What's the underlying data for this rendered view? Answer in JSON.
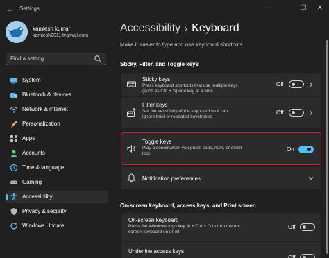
{
  "window": {
    "title": "Settings"
  },
  "user": {
    "name": "kamlesh kumar",
    "email": "kamlesh2011@gmail.com"
  },
  "search": {
    "placeholder": "Find a setting"
  },
  "sidebar": {
    "items": [
      {
        "label": "System",
        "icon": "monitor-icon",
        "color": "#4cc2ff"
      },
      {
        "label": "Bluetooth & devices",
        "icon": "bluetooth-icon",
        "color": "#4cc2ff"
      },
      {
        "label": "Network & internet",
        "icon": "wifi-icon",
        "color": "#9ecbf0"
      },
      {
        "label": "Personalization",
        "icon": "brush-icon",
        "color": "#f0a35c"
      },
      {
        "label": "Apps",
        "icon": "apps-icon",
        "color": "#b9b9b9"
      },
      {
        "label": "Accounts",
        "icon": "person-icon",
        "color": "#5fcf80"
      },
      {
        "label": "Time & language",
        "icon": "globe-clock-icon",
        "color": "#4cc2ff"
      },
      {
        "label": "Gaming",
        "icon": "gamepad-icon",
        "color": "#b9b9b9"
      },
      {
        "label": "Accessibility",
        "icon": "accessibility-icon",
        "color": "#4cc2ff",
        "active": true
      },
      {
        "label": "Privacy & security",
        "icon": "shield-icon",
        "color": "#b9b9b9"
      },
      {
        "label": "Windows Update",
        "icon": "update-icon",
        "color": "#4cc2ff"
      }
    ]
  },
  "main": {
    "breadcrumb": {
      "parent": "Accessibility",
      "separator": "›",
      "current": "Keyboard"
    },
    "subtitle": "Make it easier to type and use keyboard shortcuts",
    "sections": [
      {
        "title": "Sticky, Filter, and Toggle keys",
        "cards": [
          {
            "title": "Sticky keys",
            "desc": "Press keyboard shortcuts one key at a time",
            "desc_line1": "Press keyboard shortcuts that use multiple keys",
            "desc_line2": "(such as Ctrl + S) one key at a time",
            "state": "Off",
            "icon": "keyboard-icon"
          },
          {
            "title": "Filter keys",
            "desc_line1": "Set the sensitivity of the keyboard so it can",
            "desc_line2": "ignore brief or repeated keystrokes",
            "state": "Off",
            "icon": "filter-keyboard-icon"
          },
          {
            "title": "Toggle keys",
            "desc_line1": "Play a sound when you press caps, num, or scroll",
            "desc_line2": "lock",
            "state": "On",
            "icon": "speaker-icon"
          },
          {
            "title": "Notification preferences",
            "icon": "bell-icon"
          }
        ]
      },
      {
        "title": "On-screen keyboard, access keys, and Print screen",
        "cards": [
          {
            "title": "On-screen keyboard",
            "desc_line1": "Press the Windows logo key ⊞ + Ctrl + O to turn the on-",
            "desc_line2": "screen keyboard on or off",
            "state": "Off"
          },
          {
            "title": "Underline access keys",
            "state": "Off"
          }
        ]
      }
    ]
  },
  "colors": {
    "accent": "#4cc2ff",
    "highlight_border": "#c4262e",
    "card_bg": "#2b2b2b"
  }
}
